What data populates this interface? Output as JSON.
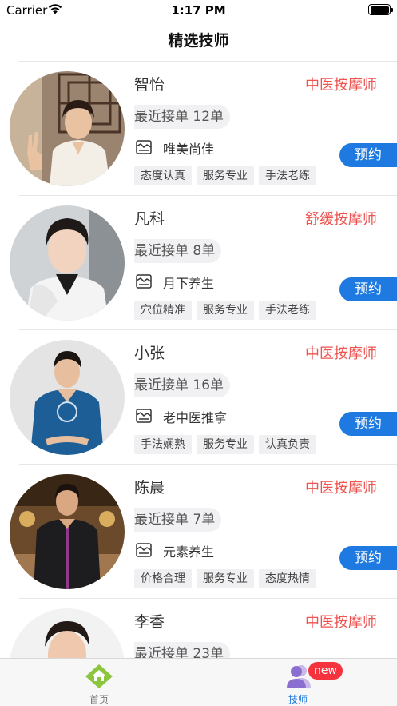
{
  "status_bar": {
    "carrier": "Carrier",
    "time": "1:17 PM"
  },
  "nav": {
    "title": "精选技师"
  },
  "technicians": [
    {
      "name": "智怡",
      "title": "中医按摩师",
      "orders": "最近接单 12单",
      "shop": "唯美尚佳",
      "tags": [
        "态度认真",
        "服务专业",
        "手法老练"
      ],
      "book_label": "预约"
    },
    {
      "name": "凡科",
      "title": "舒缓按摩师",
      "orders": "最近接单 8单",
      "shop": "月下养生",
      "tags": [
        "穴位精准",
        "服务专业",
        "手法老练"
      ],
      "book_label": "预约"
    },
    {
      "name": "小张",
      "title": "中医按摩师",
      "orders": "最近接单 16单",
      "shop": "老中医推拿",
      "tags": [
        "手法娴熟",
        "服务专业",
        "认真负责"
      ],
      "book_label": "预约"
    },
    {
      "name": "陈晨",
      "title": "中医按摩师",
      "orders": "最近接单 7单",
      "shop": "元素养生",
      "tags": [
        "价格合理",
        "服务专业",
        "态度热情"
      ],
      "book_label": "预约"
    },
    {
      "name": "李香",
      "title": "中医按摩师",
      "orders": "最近接单 23单",
      "shop": "",
      "tags": [],
      "book_label": ""
    }
  ],
  "tab_bar": {
    "home_label": "首页",
    "tech_label": "技师",
    "badge": "new"
  },
  "colors": {
    "accent_blue": "#1e7ae0",
    "title_red": "#ef5350",
    "badge_red": "#f5333f",
    "home_icon_green": "#8cc63f"
  }
}
